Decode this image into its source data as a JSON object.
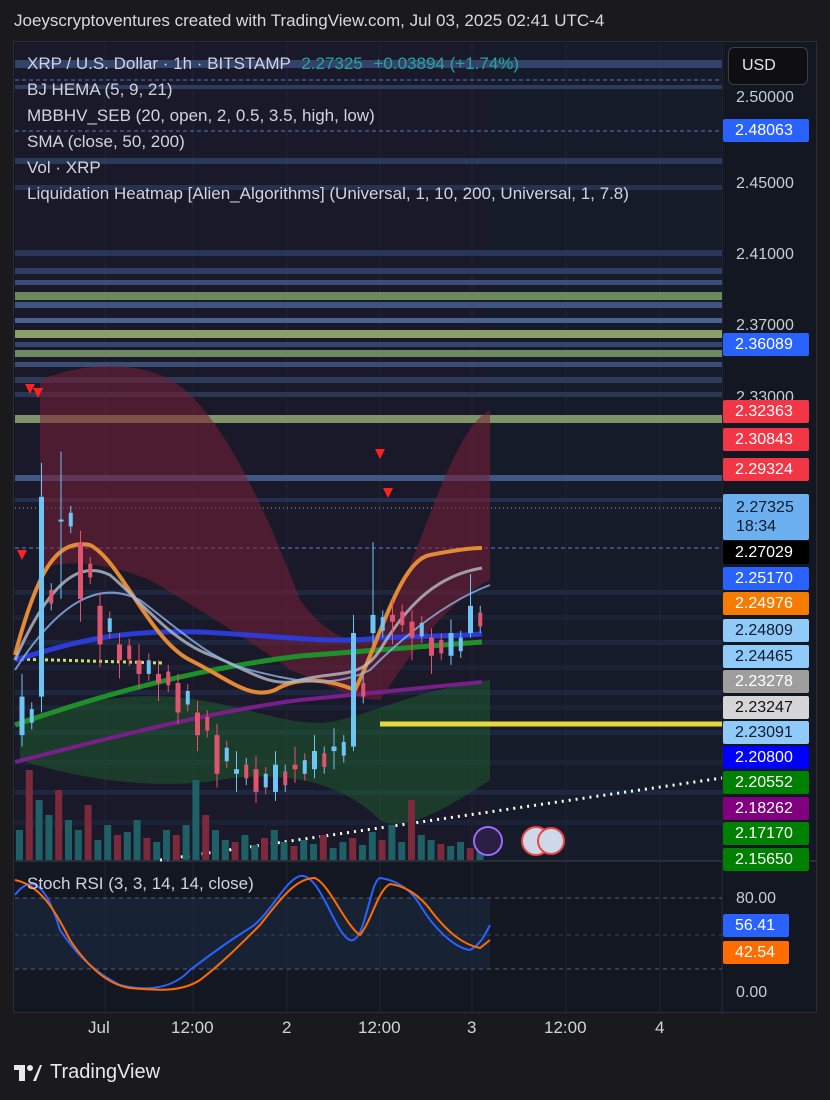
{
  "header": {
    "text": "Joeyscryptoventures created with TradingView.com, Jul 03, 2025 02:41 UTC-4"
  },
  "legend": {
    "symbol": "XRP / U.S. Dollar · 1h · BITSTAMP",
    "price": "2.27325",
    "change": "+0.03894 (+1.74%)",
    "indicators": [
      "BJ HEMA  (5, 9, 21)",
      "MBBHV_SEB (20, open, 2, 0.5, 3.5, high, low)",
      "SMA (close, 50, 200)",
      "Vol · XRP",
      "Liquidation Heatmap [Alien_Algorithms] (Universal, 1, 10, 200, Universal, 1, 7.8)"
    ]
  },
  "currency_button": "USD",
  "price_axis_ticks": [
    "2.50000",
    "2.45000",
    "2.41000",
    "2.37000",
    "2.33000"
  ],
  "price_tags": [
    {
      "label": "2.48063",
      "bg": "#2962ff",
      "fg": "#ffffff"
    },
    {
      "label": "2.36089",
      "bg": "#2962ff",
      "fg": "#ffffff"
    },
    {
      "label": "2.32363",
      "bg": "#f23645",
      "fg": "#ffffff"
    },
    {
      "label": "2.30843",
      "bg": "#f23645",
      "fg": "#ffffff"
    },
    {
      "label": "2.29324",
      "bg": "#f23645",
      "fg": "#ffffff"
    },
    {
      "label": "2.27029",
      "bg": "#000000",
      "fg": "#ffffff"
    },
    {
      "label": "2.25170",
      "bg": "#2962ff",
      "fg": "#ffffff"
    },
    {
      "label": "2.24976",
      "bg": "#f57c00",
      "fg": "#ffffff"
    },
    {
      "label": "2.24809",
      "bg": "#90caf9",
      "fg": "#0c1a2e"
    },
    {
      "label": "2.24465",
      "bg": "#90caf9",
      "fg": "#0c1a2e"
    },
    {
      "label": "2.23278",
      "bg": "#9e9e9e",
      "fg": "#ffffff"
    },
    {
      "label": "2.23247",
      "bg": "#d6d6d6",
      "fg": "#111111"
    },
    {
      "label": "2.23091",
      "bg": "#90caf9",
      "fg": "#0c1a2e"
    },
    {
      "label": "2.20800",
      "bg": "#0000ff",
      "fg": "#ffffff"
    },
    {
      "label": "2.20552",
      "bg": "#008000",
      "fg": "#ffffff"
    },
    {
      "label": "2.18262",
      "bg": "#800080",
      "fg": "#ffffff"
    },
    {
      "label": "2.17170",
      "bg": "#008000",
      "fg": "#ffffff"
    },
    {
      "label": "2.15650",
      "bg": "#008000",
      "fg": "#ffffff"
    }
  ],
  "last_price": {
    "value": "2.27325",
    "countdown": "18:34"
  },
  "stoch": {
    "legend": "Stoch RSI (3, 3, 14, 14, close)",
    "ticks": [
      "80.00",
      "0.00"
    ],
    "k_value": "56.41",
    "d_value": "42.54",
    "k_color": "#2962ff",
    "d_color": "#ff6d00"
  },
  "time_axis": [
    "Jul",
    "12:00",
    "2",
    "12:00",
    "3",
    "12:00",
    "4"
  ],
  "footer": {
    "brand": "TradingView"
  },
  "chart_data": {
    "type": "candlestick",
    "symbol": "XRP / U.S. Dollar",
    "interval": "1h",
    "exchange": "BITSTAMP",
    "y_range": [
      2.15,
      2.51
    ],
    "last": 2.27325,
    "candles_approx": [
      [
        2.205,
        2.222,
        2.2,
        2.232
      ],
      [
        2.222,
        2.31,
        2.215,
        2.325
      ],
      [
        2.3,
        2.3,
        2.265,
        2.33
      ],
      [
        2.29,
        2.265,
        2.255,
        2.295
      ],
      [
        2.262,
        2.245,
        2.235,
        2.268
      ],
      [
        2.245,
        2.238,
        2.23,
        2.25
      ],
      [
        2.238,
        2.232,
        2.225,
        2.245
      ],
      [
        2.232,
        2.228,
        2.22,
        2.238
      ],
      [
        2.228,
        2.215,
        2.21,
        2.232
      ],
      [
        2.215,
        2.205,
        2.198,
        2.22
      ],
      [
        2.205,
        2.188,
        2.182,
        2.21
      ],
      [
        2.188,
        2.19,
        2.18,
        2.198
      ],
      [
        2.19,
        2.18,
        2.175,
        2.196
      ],
      [
        2.18,
        2.192,
        2.176,
        2.198
      ],
      [
        2.192,
        2.19,
        2.184,
        2.2
      ],
      [
        2.19,
        2.198,
        2.186,
        2.205
      ],
      [
        2.198,
        2.2,
        2.19,
        2.208
      ],
      [
        2.2,
        2.25,
        2.198,
        2.258
      ],
      [
        2.25,
        2.258,
        2.245,
        2.29
      ],
      [
        2.258,
        2.255,
        2.245,
        2.265
      ],
      [
        2.255,
        2.248,
        2.238,
        2.26
      ],
      [
        2.248,
        2.24,
        2.232,
        2.252
      ],
      [
        2.24,
        2.25,
        2.236,
        2.256
      ],
      [
        2.25,
        2.262,
        2.248,
        2.276
      ]
    ]
  }
}
